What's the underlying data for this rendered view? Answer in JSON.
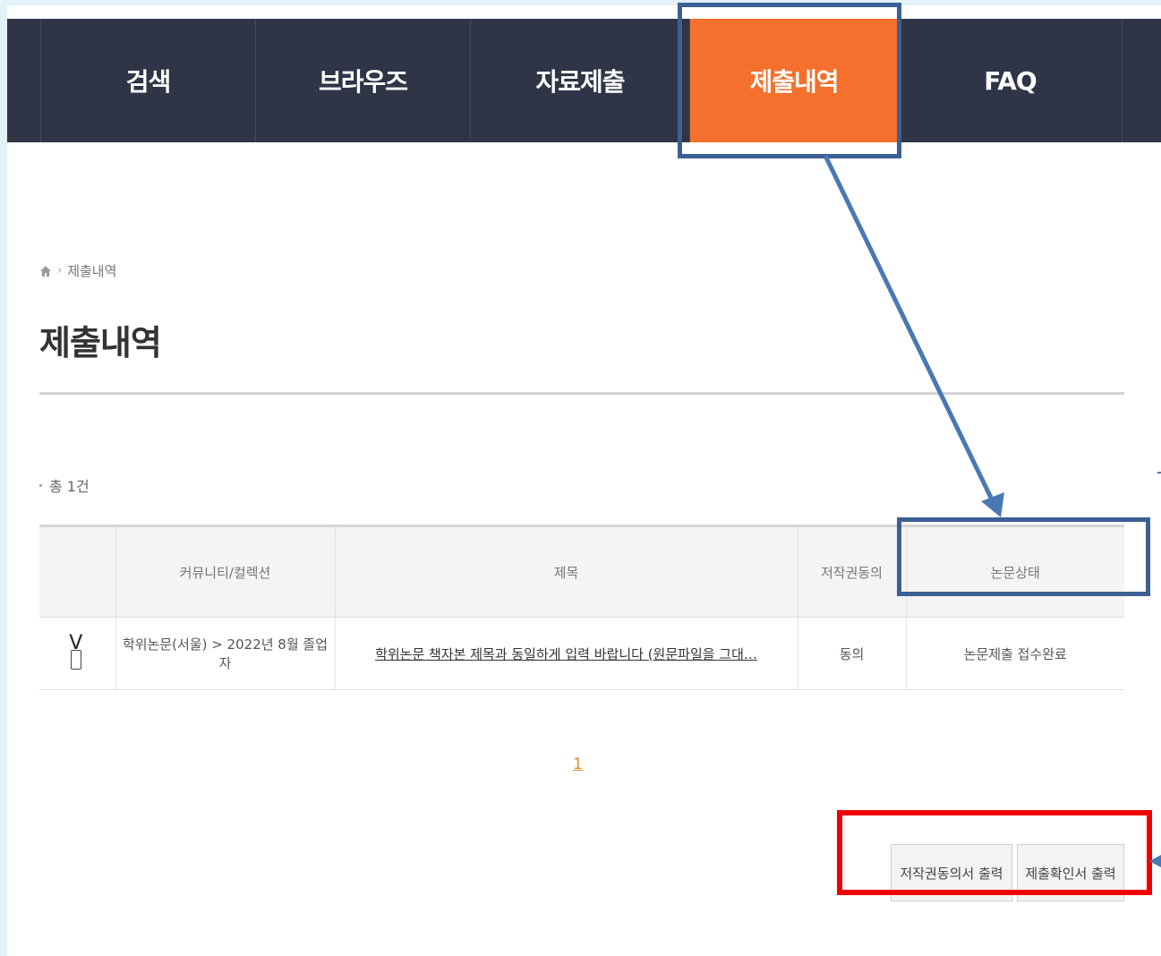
{
  "nav": {
    "items": [
      {
        "label": "검색",
        "active": false
      },
      {
        "label": "브라우즈",
        "active": false
      },
      {
        "label": "자료제출",
        "active": false
      },
      {
        "label": "제출내역",
        "active": true
      },
      {
        "label": "FAQ",
        "active": false
      }
    ]
  },
  "breadcrumb": {
    "home_icon": "home-icon",
    "separator": "›",
    "current": "제출내역"
  },
  "page_title": "제출내역",
  "count_text": "총 1건",
  "table": {
    "headers": [
      "",
      "커뮤니티/컬렉션",
      "제목",
      "저작권동의",
      "논문상태"
    ],
    "rows": [
      {
        "check_mark": "V",
        "collection": "학위논문(서울) > 2022년 8월 졸업자",
        "title": "학위논문 책자본 제목과 동일하게 입력 바랍니다 (원문파일을 그대…",
        "copyright": "동의",
        "status": "논문제출 접수완료"
      }
    ]
  },
  "pagination": {
    "current": "1"
  },
  "buttons": {
    "print_copyright": "저작권동의서 출력",
    "print_confirmation": "제출확인서 출력"
  },
  "colors": {
    "nav_bg": "#2f3547",
    "nav_active": "#f4702c",
    "annotation_blue": "#4a78b5",
    "annotation_red": "#f20000"
  }
}
